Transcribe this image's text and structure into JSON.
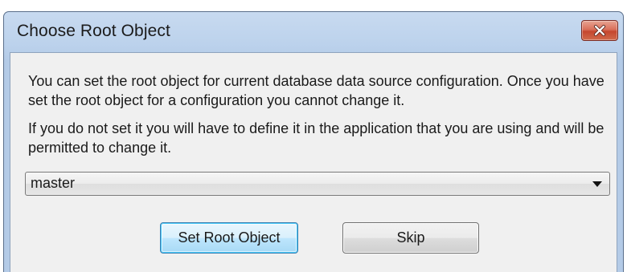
{
  "window": {
    "title": "Choose Root Object",
    "close_icon": "close-icon"
  },
  "message": {
    "paragraph1": "You can set the root object for current database data source configuration. Once you have set the root object for a configuration you cannot change it.",
    "paragraph2": "If you do not set it you will have to define it in the application that you are using and will be permitted to change it."
  },
  "root_object_select": {
    "selected_value": "master",
    "dropdown_icon": "chevron-down-icon"
  },
  "buttons": {
    "set_root_object_label": "Set Root Object",
    "skip_label": "Skip"
  },
  "colors": {
    "title_bar": "#bcd2ec",
    "client_background": "#f0f0f0",
    "close_button": "#c5472e",
    "default_button_border": "#3c7fb1"
  }
}
